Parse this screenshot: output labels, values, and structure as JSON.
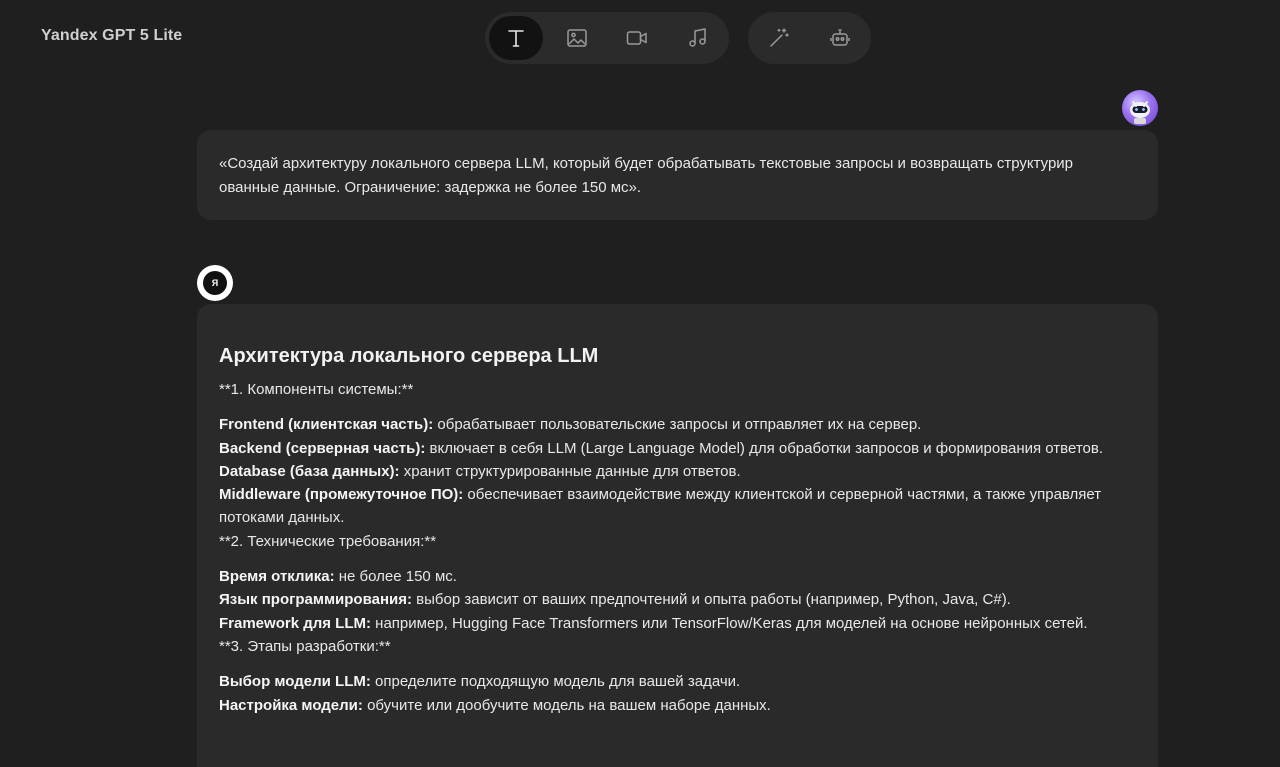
{
  "app": {
    "title": "Yandex GPT 5 Lite"
  },
  "modes": {
    "group1": [
      {
        "name": "text-mode",
        "icon": "text-icon",
        "active": true
      },
      {
        "name": "image-mode",
        "icon": "image-icon",
        "active": false
      },
      {
        "name": "video-mode",
        "icon": "video-camera-icon",
        "active": false
      },
      {
        "name": "music-mode",
        "icon": "music-note-icon",
        "active": false
      }
    ],
    "group2": [
      {
        "name": "magic-mode",
        "icon": "magic-wand-icon",
        "active": false
      },
      {
        "name": "agent-mode",
        "icon": "robot-icon",
        "active": false
      }
    ]
  },
  "user_message": {
    "text": "«Создай архитектуру локального сервера LLM, который будет обрабатывать текстовые запросы и возвращать структурир ованные данные. Ограничение: задержка не более 150 мс»."
  },
  "assistant": {
    "avatar_letter": "Я",
    "title": "Архитектура локального сервера LLM",
    "section1": "**1. Компоненты системы:**",
    "s1_items": [
      {
        "term": "Frontend (клиентская часть):",
        "desc": " обрабатывает пользовательские запросы и отправляет их на сервер."
      },
      {
        "term": "Backend (серверная часть):",
        "desc": " включает в себя LLM (Large Language Model) для обработки запросов и формирования ответов."
      },
      {
        "term": "Database (база данных):",
        "desc": " хранит структурированные данные для ответов."
      },
      {
        "term": "Middleware (промежуточное ПО):",
        "desc": " обеспечивает взаимодействие между клиентской и серверной частями, а также управляет потоками данных."
      }
    ],
    "section2": "**2. Технические требования:**",
    "s2_items": [
      {
        "term": "Время отклика:",
        "desc": " не более 150 мс."
      },
      {
        "term": "Язык программирования:",
        "desc": " выбор зависит от ваших предпочтений и опыта работы (например, Python, Java, C#)."
      },
      {
        "term": "Framework для LLM:",
        "desc": " например, Hugging Face Transformers или TensorFlow/Keras для моделей на основе нейронных сетей."
      }
    ],
    "section3": "**3. Этапы разработки:**",
    "s3_items": [
      {
        "term": "Выбор модели LLM:",
        "desc": " определите подходящую модель для вашей задачи."
      },
      {
        "term": "Настройка модели:",
        "desc": " обучите или дообучите модель на вашем наборе данных."
      }
    ]
  },
  "colors": {
    "background": "#1f1f1f",
    "bubble": "#2a2a2a",
    "toolbar": "#2b2b2b",
    "active_tab": "#121212",
    "avatar_accent": "#9a72f0"
  }
}
